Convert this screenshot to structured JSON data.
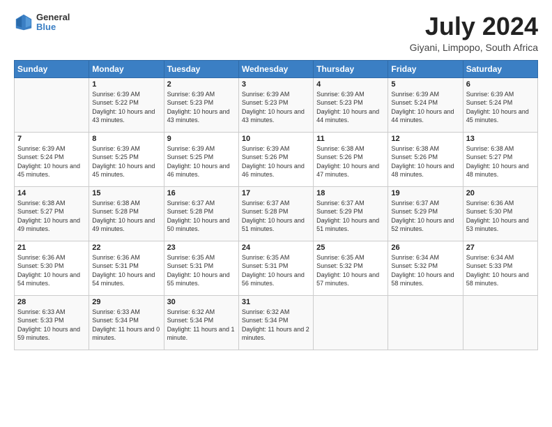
{
  "logo": {
    "line1": "General",
    "line2": "Blue"
  },
  "title": "July 2024",
  "location": "Giyani, Limpopo, South Africa",
  "headers": [
    "Sunday",
    "Monday",
    "Tuesday",
    "Wednesday",
    "Thursday",
    "Friday",
    "Saturday"
  ],
  "weeks": [
    [
      {
        "day": "",
        "sunrise": "",
        "sunset": "",
        "daylight": ""
      },
      {
        "day": "1",
        "sunrise": "Sunrise: 6:39 AM",
        "sunset": "Sunset: 5:22 PM",
        "daylight": "Daylight: 10 hours and 43 minutes."
      },
      {
        "day": "2",
        "sunrise": "Sunrise: 6:39 AM",
        "sunset": "Sunset: 5:23 PM",
        "daylight": "Daylight: 10 hours and 43 minutes."
      },
      {
        "day": "3",
        "sunrise": "Sunrise: 6:39 AM",
        "sunset": "Sunset: 5:23 PM",
        "daylight": "Daylight: 10 hours and 43 minutes."
      },
      {
        "day": "4",
        "sunrise": "Sunrise: 6:39 AM",
        "sunset": "Sunset: 5:23 PM",
        "daylight": "Daylight: 10 hours and 44 minutes."
      },
      {
        "day": "5",
        "sunrise": "Sunrise: 6:39 AM",
        "sunset": "Sunset: 5:24 PM",
        "daylight": "Daylight: 10 hours and 44 minutes."
      },
      {
        "day": "6",
        "sunrise": "Sunrise: 6:39 AM",
        "sunset": "Sunset: 5:24 PM",
        "daylight": "Daylight: 10 hours and 45 minutes."
      }
    ],
    [
      {
        "day": "7",
        "sunrise": "Sunrise: 6:39 AM",
        "sunset": "Sunset: 5:24 PM",
        "daylight": "Daylight: 10 hours and 45 minutes."
      },
      {
        "day": "8",
        "sunrise": "Sunrise: 6:39 AM",
        "sunset": "Sunset: 5:25 PM",
        "daylight": "Daylight: 10 hours and 45 minutes."
      },
      {
        "day": "9",
        "sunrise": "Sunrise: 6:39 AM",
        "sunset": "Sunset: 5:25 PM",
        "daylight": "Daylight: 10 hours and 46 minutes."
      },
      {
        "day": "10",
        "sunrise": "Sunrise: 6:39 AM",
        "sunset": "Sunset: 5:26 PM",
        "daylight": "Daylight: 10 hours and 46 minutes."
      },
      {
        "day": "11",
        "sunrise": "Sunrise: 6:38 AM",
        "sunset": "Sunset: 5:26 PM",
        "daylight": "Daylight: 10 hours and 47 minutes."
      },
      {
        "day": "12",
        "sunrise": "Sunrise: 6:38 AM",
        "sunset": "Sunset: 5:26 PM",
        "daylight": "Daylight: 10 hours and 48 minutes."
      },
      {
        "day": "13",
        "sunrise": "Sunrise: 6:38 AM",
        "sunset": "Sunset: 5:27 PM",
        "daylight": "Daylight: 10 hours and 48 minutes."
      }
    ],
    [
      {
        "day": "14",
        "sunrise": "Sunrise: 6:38 AM",
        "sunset": "Sunset: 5:27 PM",
        "daylight": "Daylight: 10 hours and 49 minutes."
      },
      {
        "day": "15",
        "sunrise": "Sunrise: 6:38 AM",
        "sunset": "Sunset: 5:28 PM",
        "daylight": "Daylight: 10 hours and 49 minutes."
      },
      {
        "day": "16",
        "sunrise": "Sunrise: 6:37 AM",
        "sunset": "Sunset: 5:28 PM",
        "daylight": "Daylight: 10 hours and 50 minutes."
      },
      {
        "day": "17",
        "sunrise": "Sunrise: 6:37 AM",
        "sunset": "Sunset: 5:28 PM",
        "daylight": "Daylight: 10 hours and 51 minutes."
      },
      {
        "day": "18",
        "sunrise": "Sunrise: 6:37 AM",
        "sunset": "Sunset: 5:29 PM",
        "daylight": "Daylight: 10 hours and 51 minutes."
      },
      {
        "day": "19",
        "sunrise": "Sunrise: 6:37 AM",
        "sunset": "Sunset: 5:29 PM",
        "daylight": "Daylight: 10 hours and 52 minutes."
      },
      {
        "day": "20",
        "sunrise": "Sunrise: 6:36 AM",
        "sunset": "Sunset: 5:30 PM",
        "daylight": "Daylight: 10 hours and 53 minutes."
      }
    ],
    [
      {
        "day": "21",
        "sunrise": "Sunrise: 6:36 AM",
        "sunset": "Sunset: 5:30 PM",
        "daylight": "Daylight: 10 hours and 54 minutes."
      },
      {
        "day": "22",
        "sunrise": "Sunrise: 6:36 AM",
        "sunset": "Sunset: 5:31 PM",
        "daylight": "Daylight: 10 hours and 54 minutes."
      },
      {
        "day": "23",
        "sunrise": "Sunrise: 6:35 AM",
        "sunset": "Sunset: 5:31 PM",
        "daylight": "Daylight: 10 hours and 55 minutes."
      },
      {
        "day": "24",
        "sunrise": "Sunrise: 6:35 AM",
        "sunset": "Sunset: 5:31 PM",
        "daylight": "Daylight: 10 hours and 56 minutes."
      },
      {
        "day": "25",
        "sunrise": "Sunrise: 6:35 AM",
        "sunset": "Sunset: 5:32 PM",
        "daylight": "Daylight: 10 hours and 57 minutes."
      },
      {
        "day": "26",
        "sunrise": "Sunrise: 6:34 AM",
        "sunset": "Sunset: 5:32 PM",
        "daylight": "Daylight: 10 hours and 58 minutes."
      },
      {
        "day": "27",
        "sunrise": "Sunrise: 6:34 AM",
        "sunset": "Sunset: 5:33 PM",
        "daylight": "Daylight: 10 hours and 58 minutes."
      }
    ],
    [
      {
        "day": "28",
        "sunrise": "Sunrise: 6:33 AM",
        "sunset": "Sunset: 5:33 PM",
        "daylight": "Daylight: 10 hours and 59 minutes."
      },
      {
        "day": "29",
        "sunrise": "Sunrise: 6:33 AM",
        "sunset": "Sunset: 5:34 PM",
        "daylight": "Daylight: 11 hours and 0 minutes."
      },
      {
        "day": "30",
        "sunrise": "Sunrise: 6:32 AM",
        "sunset": "Sunset: 5:34 PM",
        "daylight": "Daylight: 11 hours and 1 minute."
      },
      {
        "day": "31",
        "sunrise": "Sunrise: 6:32 AM",
        "sunset": "Sunset: 5:34 PM",
        "daylight": "Daylight: 11 hours and 2 minutes."
      },
      {
        "day": "",
        "sunrise": "",
        "sunset": "",
        "daylight": ""
      },
      {
        "day": "",
        "sunrise": "",
        "sunset": "",
        "daylight": ""
      },
      {
        "day": "",
        "sunrise": "",
        "sunset": "",
        "daylight": ""
      }
    ]
  ]
}
